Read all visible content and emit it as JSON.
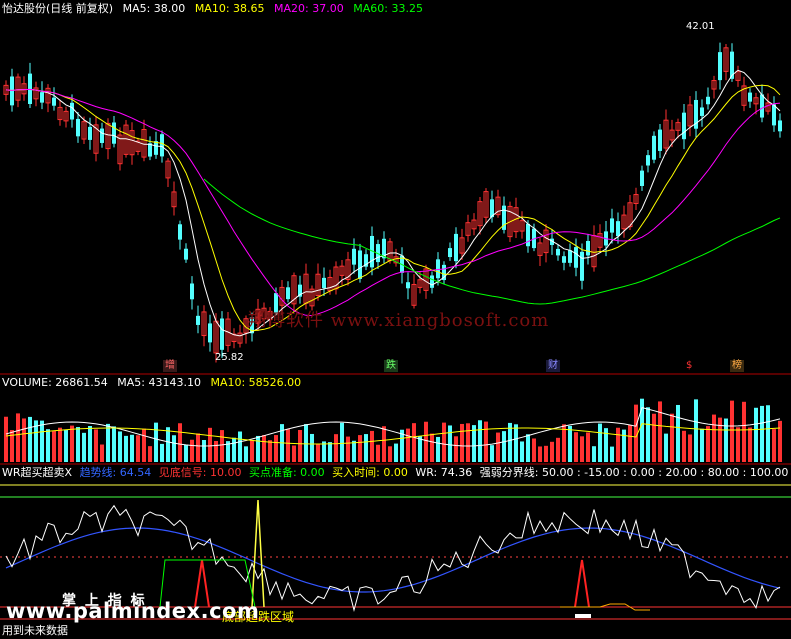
{
  "main_header": {
    "title": "怡达股份(日线 前复权)",
    "ma5": "MA5: 38.00",
    "ma10": "MA10: 38.65",
    "ma20": "MA20: 37.00",
    "ma60": "MA60: 33.25"
  },
  "price_labels": {
    "high": "42.01",
    "low": "25.82"
  },
  "markers": [
    {
      "text": "增"
    },
    {
      "text": "跌"
    },
    {
      "text": "财"
    },
    {
      "text": "$"
    },
    {
      "text": "榜"
    }
  ],
  "watermark": "翔博软件 www.xiangbosoft.com",
  "volume_header": {
    "volume": "VOLUME: 26861.54",
    "ma5": "MA5: 43143.10",
    "ma10": "MA10: 58526.00"
  },
  "indicator_header": {
    "name": "WR超买超卖X",
    "trend": "趋势线: 64.54",
    "bottom_signal": "见底信号: 10.00",
    "buy_prepare": "买点准备: 0.00",
    "buy_time": "买入时间: 0.00",
    "wr": "WR: 74.36",
    "boundary": "强弱分界线: 50.00",
    "vals": ": -15.00 : 0.00 : 20.00 : 80.00 : 100.00"
  },
  "indicator_overlay": {
    "palm": "掌 上 指 标",
    "zone": "底部超跌区域"
  },
  "footer": {
    "url": "www.palmindex.com",
    "note": "用到未来数据"
  },
  "colors": {
    "up": "#ff3232",
    "down": "#54ffff",
    "ma5": "#ffffff",
    "ma10": "#ffff00",
    "ma20": "#ff00ff",
    "ma60": "#00ff00",
    "grid": "#8b0000"
  }
}
